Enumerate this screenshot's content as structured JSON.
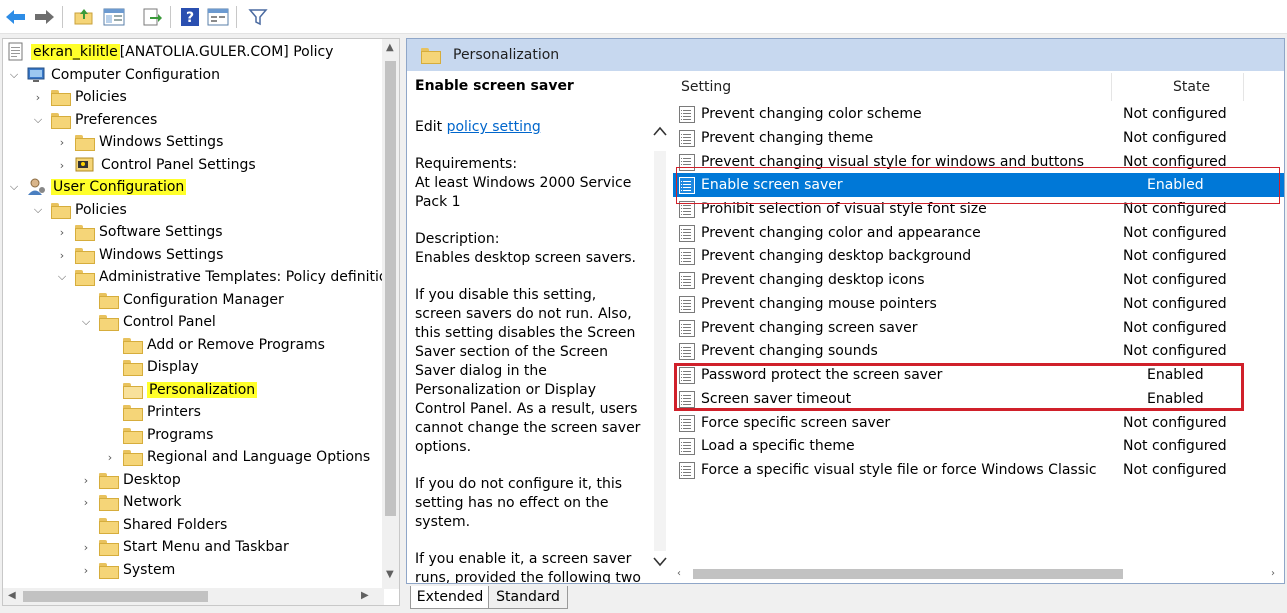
{
  "toolbar": {
    "icons": [
      "back-arrow-icon",
      "forward-arrow-icon",
      "up-folder-icon",
      "show-hide-tree-icon",
      "export-list-icon",
      "help-icon",
      "properties-icon",
      "filter-icon"
    ]
  },
  "tree": {
    "root_label_highlight": "ekran_kilitle",
    "root_label_rest": " [ANATOLIA.GULER.COM] Policy",
    "computer_configuration": "Computer Configuration",
    "cc_policies": "Policies",
    "cc_preferences": "Preferences",
    "cc_windows_settings": "Windows Settings",
    "cc_control_panel_settings": "Control Panel Settings",
    "user_configuration": "User Configuration",
    "uc_policies": "Policies",
    "software_settings": "Software Settings",
    "windows_settings": "Windows Settings",
    "admin_templates": "Administrative Templates: Policy definitions",
    "configuration_manager": "Configuration Manager",
    "control_panel": "Control Panel",
    "add_remove_programs": "Add or Remove Programs",
    "display": "Display",
    "personalization": "Personalization",
    "printers": "Printers",
    "programs": "Programs",
    "regional": "Regional and Language Options",
    "desktop": "Desktop",
    "network": "Network",
    "shared_folders": "Shared Folders",
    "start_menu": "Start Menu and Taskbar",
    "system": "System"
  },
  "right": {
    "header": "Personalization",
    "description": {
      "title": "Enable screen saver",
      "edit_prefix": "Edit ",
      "edit_link": "policy setting",
      "requirements_label": "Requirements:",
      "requirements_text": "At least Windows 2000 Service Pack 1",
      "description_label": "Description:",
      "description_text": "Enables desktop screen savers.",
      "para1": "If you disable this setting, screen savers do not run. Also, this setting disables the Screen Saver section of the Screen Saver dialog in the Personalization or Display Control Panel. As a result, users cannot change the screen saver options.",
      "para2": "If you do not configure it, this setting has no effect on the system.",
      "para3": "If you enable it, a screen saver runs, provided the following two conditions hold: First, a valid"
    },
    "columns": {
      "setting": "Setting",
      "state": "State"
    },
    "rows": [
      {
        "name": "Prevent changing color scheme",
        "state": "Not configured"
      },
      {
        "name": "Prevent changing theme",
        "state": "Not configured"
      },
      {
        "name": "Prevent changing visual style for windows and buttons",
        "state": "Not configured"
      },
      {
        "name": "Enable screen saver",
        "state": "Enabled"
      },
      {
        "name": "Prohibit selection of visual style font size",
        "state": "Not configured"
      },
      {
        "name": "Prevent changing color and appearance",
        "state": "Not configured"
      },
      {
        "name": "Prevent changing desktop background",
        "state": "Not configured"
      },
      {
        "name": "Prevent changing desktop icons",
        "state": "Not configured"
      },
      {
        "name": "Prevent changing mouse pointers",
        "state": "Not configured"
      },
      {
        "name": "Prevent changing screen saver",
        "state": "Not configured"
      },
      {
        "name": "Prevent changing sounds",
        "state": "Not configured"
      },
      {
        "name": "Password protect the screen saver",
        "state": "Enabled"
      },
      {
        "name": "Screen saver timeout",
        "state": "Enabled"
      },
      {
        "name": "Force specific screen saver",
        "state": "Not configured"
      },
      {
        "name": "Load a specific theme",
        "state": "Not configured"
      },
      {
        "name": "Force a specific visual style file or force Windows Classic",
        "state": "Not configured"
      }
    ]
  },
  "tabs": {
    "extended": "Extended",
    "standard": "Standard"
  },
  "colors": {
    "selection": "#0078d7",
    "highlight": "#ffff2a",
    "annotation_red": "#d0202a",
    "header": "#c7d8ef"
  }
}
